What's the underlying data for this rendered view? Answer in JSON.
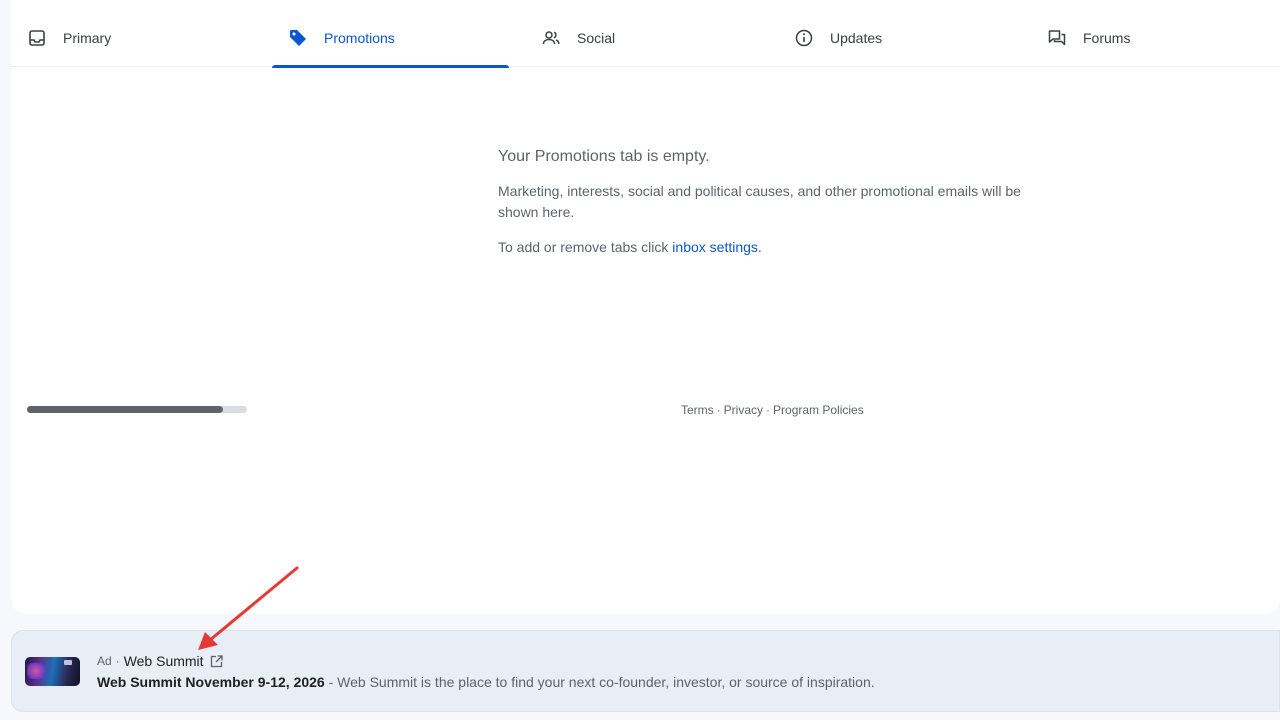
{
  "tabs": [
    {
      "label": "Primary",
      "icon": "inbox-icon",
      "active": false
    },
    {
      "label": "Promotions",
      "icon": "tag-icon",
      "active": true
    },
    {
      "label": "Social",
      "icon": "people-icon",
      "active": false
    },
    {
      "label": "Updates",
      "icon": "info-icon",
      "active": false
    },
    {
      "label": "Forums",
      "icon": "forum-icon",
      "active": false
    }
  ],
  "empty_state": {
    "title": "Your Promotions tab is empty.",
    "description": "Marketing, interests, social and political causes, and other promotional emails will be shown here.",
    "hint_prefix": "To add or remove tabs click ",
    "hint_link": "inbox settings",
    "hint_suffix": "."
  },
  "storage": {
    "used_fraction": 0.89
  },
  "footer": {
    "terms": "Terms",
    "sep1": "·",
    "privacy": "Privacy",
    "sep2": "·",
    "policies": "Program Policies"
  },
  "ad": {
    "badge": "Ad",
    "dot": "·",
    "sender": "Web Summit",
    "subject": "Web Summit November 9-12, 2026",
    "separator": " - ",
    "snippet": "Web Summit is the place to find your next co-founder, investor, or source of inspiration."
  },
  "colors": {
    "accent": "#0b57d0",
    "annotation_arrow": "#e53935"
  }
}
